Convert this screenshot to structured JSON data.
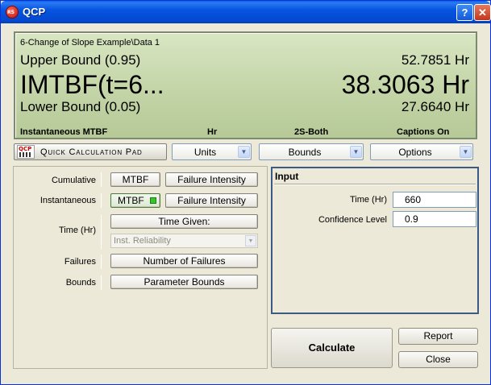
{
  "window": {
    "title": "QCP",
    "help_glyph": "?",
    "close_glyph": "✕",
    "app_icon_text": "RS"
  },
  "display": {
    "path": "6-Change of Slope Example\\Data 1",
    "upper_label": "Upper Bound (0.95)",
    "upper_value": "52.7851 Hr",
    "main_label": "IMTBF(t=6...",
    "main_value": "38.3063 Hr",
    "lower_label": "Lower Bound (0.05)",
    "lower_value": "27.6640 Hr",
    "footer": {
      "metric": "Instantaneous MTBF",
      "units": "Hr",
      "bounds": "2S-Both",
      "captions": "Captions On"
    }
  },
  "toolbar": {
    "qcp_logo_text": "QCP",
    "qcp_label": "Quick Calculation Pad",
    "units_label": "Units",
    "bounds_label": "Bounds",
    "options_label": "Options"
  },
  "left": {
    "cumulative_label": "Cumulative",
    "instantaneous_label": "Instantaneous",
    "time_label": "Time (Hr)",
    "failures_label": "Failures",
    "bounds_label": "Bounds",
    "mtbf_button": "MTBF",
    "failure_intensity_button": "Failure Intensity",
    "time_given_button": "Time Given:",
    "inst_reliability": "Inst. Reliability",
    "number_of_failures_button": "Number of Failures",
    "parameter_bounds_button": "Parameter Bounds"
  },
  "input": {
    "title": "Input",
    "time_label": "Time (Hr)",
    "time_value": "660",
    "confidence_label": "Confidence Level",
    "confidence_value": "0.9"
  },
  "actions": {
    "calculate": "Calculate",
    "report": "Report",
    "close": "Close"
  },
  "colors": {
    "title_bar": "#0655e1",
    "display_bg": "#c5d6a9",
    "active_led": "#36c62c"
  }
}
